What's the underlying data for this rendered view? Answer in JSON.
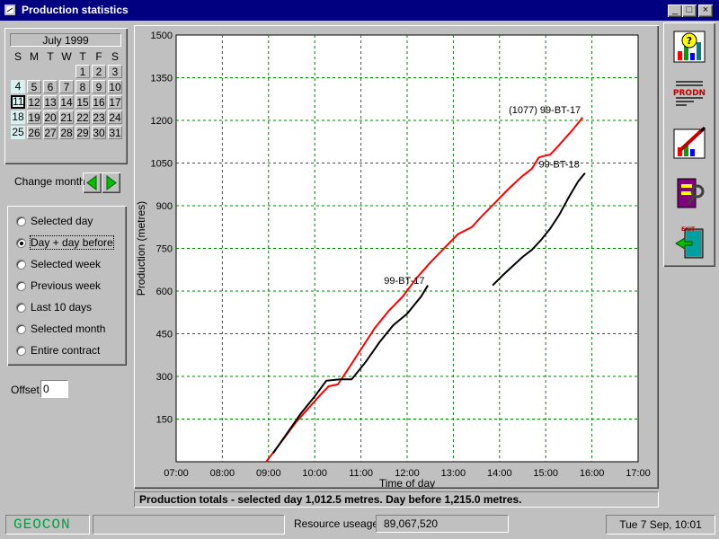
{
  "window": {
    "title": "Production statistics",
    "controls": [
      "_",
      "□",
      "×"
    ]
  },
  "calendar": {
    "month_label": "July 1999",
    "dow": [
      "S",
      "M",
      "T",
      "W",
      "T",
      "F",
      "S"
    ],
    "weeks": [
      [
        "",
        "",
        "",
        "",
        "1",
        "2",
        "3"
      ],
      [
        "4",
        "5",
        "6",
        "7",
        "8",
        "9",
        "10"
      ],
      [
        "11",
        "12",
        "13",
        "14",
        "15",
        "16",
        "17"
      ],
      [
        "18",
        "19",
        "20",
        "21",
        "22",
        "23",
        "24"
      ],
      [
        "25",
        "26",
        "27",
        "28",
        "29",
        "30",
        "31"
      ]
    ],
    "selected_day": "11"
  },
  "change_month": {
    "label": "Change month",
    "prev_icon": "left-arrow-icon",
    "next_icon": "right-arrow-icon",
    "arrow_color": "#00c000"
  },
  "period_options": {
    "items": [
      {
        "label": "Selected day",
        "checked": false
      },
      {
        "label": "Day + day before",
        "checked": true
      },
      {
        "label": "Selected week",
        "checked": false
      },
      {
        "label": "Previous week",
        "checked": false
      },
      {
        "label": "Last 10 days",
        "checked": false
      },
      {
        "label": "Selected month",
        "checked": false
      },
      {
        "label": "Entire contract",
        "checked": false
      }
    ]
  },
  "offset": {
    "label": "Offset",
    "value": "0"
  },
  "chart_data": {
    "type": "line",
    "title": "",
    "xlabel": "Time of day",
    "ylabel": "Production (metres)",
    "xlim": [
      7,
      17
    ],
    "ylim": [
      0,
      1500
    ],
    "x_ticks": [
      "07:00",
      "08:00",
      "09:00",
      "10:00",
      "11:00",
      "12:00",
      "13:00",
      "14:00",
      "15:00",
      "16:00",
      "17:00"
    ],
    "y_ticks": [
      "1500",
      "1350",
      "1200",
      "1050",
      "900",
      "750",
      "600",
      "450",
      "300",
      "150"
    ],
    "y_tick_values": [
      1500,
      1350,
      1200,
      1050,
      900,
      750,
      600,
      450,
      300,
      150
    ],
    "grid": true,
    "grid_color": "#008000",
    "series": [
      {
        "name": "(1077) 99-BT-17",
        "color": "#ff0000",
        "points": [
          [
            8.95,
            0
          ],
          [
            9.3,
            75
          ],
          [
            9.6,
            140
          ],
          [
            9.9,
            195
          ],
          [
            10.15,
            240
          ],
          [
            10.3,
            265
          ],
          [
            10.5,
            272
          ],
          [
            10.7,
            320
          ],
          [
            11.0,
            395
          ],
          [
            11.3,
            470
          ],
          [
            11.6,
            530
          ],
          [
            11.9,
            580
          ],
          [
            12.2,
            645
          ],
          [
            12.5,
            700
          ],
          [
            12.8,
            750
          ],
          [
            13.1,
            800
          ],
          [
            13.4,
            825
          ],
          [
            13.6,
            860
          ],
          [
            13.9,
            910
          ],
          [
            14.2,
            960
          ],
          [
            14.5,
            1005
          ],
          [
            14.7,
            1030
          ],
          [
            14.85,
            1070
          ],
          [
            15.1,
            1080
          ],
          [
            15.3,
            1115
          ],
          [
            15.6,
            1170
          ],
          [
            15.8,
            1210
          ]
        ],
        "label_text": "(1077) 99-BT-17",
        "label_x": 14.2,
        "label_y": 1225
      },
      {
        "name": "99-BT-17",
        "color": "#000000",
        "points": [
          [
            9.1,
            30
          ],
          [
            9.4,
            100
          ],
          [
            9.7,
            170
          ],
          [
            10.0,
            230
          ],
          [
            10.25,
            285
          ],
          [
            10.55,
            290
          ],
          [
            10.8,
            290
          ],
          [
            11.1,
            350
          ],
          [
            11.4,
            420
          ],
          [
            11.7,
            480
          ],
          [
            12.0,
            520
          ],
          [
            12.3,
            580
          ],
          [
            12.45,
            620
          ]
        ],
        "label_text": "99-BT-17",
        "label_x": 11.5,
        "label_y": 625
      },
      {
        "name": "99-BT-18",
        "color": "#000000",
        "points": [
          [
            13.85,
            620
          ],
          [
            14.1,
            660
          ],
          [
            14.3,
            690
          ],
          [
            14.5,
            720
          ],
          [
            14.7,
            745
          ],
          [
            14.9,
            780
          ],
          [
            15.1,
            820
          ],
          [
            15.3,
            870
          ],
          [
            15.5,
            930
          ],
          [
            15.7,
            985
          ],
          [
            15.85,
            1015
          ]
        ],
        "label_text": "99-BT-18",
        "label_x": 14.85,
        "label_y": 1035
      }
    ]
  },
  "totals": {
    "text": "Production totals - selected day 1,012.5 metres.  Day before 1,215.0 metres."
  },
  "toolbar": {
    "buttons": [
      {
        "icon": "help-chart-icon",
        "tooltip": ""
      },
      {
        "icon": "prodn-icon",
        "text": "PRODN"
      },
      {
        "icon": "edit-chart-icon",
        "tooltip": ""
      },
      {
        "icon": "tools-icon",
        "tooltip": ""
      },
      {
        "icon": "exit-door-icon",
        "text": "EXIT"
      }
    ]
  },
  "statusbar": {
    "brand": "GEOCON",
    "resource_label": "Resource useage",
    "resource_value": "89,067,520",
    "clock": "Tue 7 Sep, 10:01"
  }
}
